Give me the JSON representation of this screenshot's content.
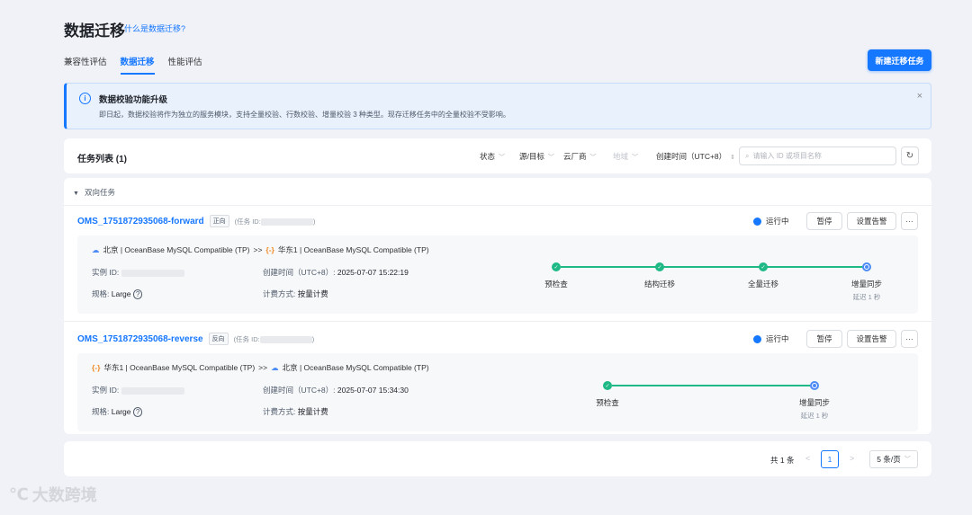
{
  "header": {
    "title": "数据迁移",
    "help_link": "什么是数据迁移?"
  },
  "tabs": [
    {
      "label": "兼容性评估",
      "active": false
    },
    {
      "label": "数据迁移",
      "active": true
    },
    {
      "label": "性能评估",
      "active": false
    }
  ],
  "new_button": "新建迁移任务",
  "notice": {
    "title": "数据校验功能升级",
    "desc": "即日起，数据校验将作为独立的服务模块，支持全量校验、行数校验、增量校验 3 种类型。现存迁移任务中的全量校验不受影响。",
    "close": "×"
  },
  "list": {
    "title": "任务列表 (1)",
    "filters": [
      "状态",
      "源/目标",
      "云厂商",
      "地域",
      "创建时间（UTC+8）"
    ],
    "search_placeholder": "请输入 ID 或项目名称"
  },
  "group": {
    "label": "双向任务"
  },
  "tasks": [
    {
      "name": "OMS_1751872935068-forward",
      "tag": "正向",
      "id_label": "(任务 ID:",
      "id_close": ")",
      "status": "运行中",
      "pause": "暂停",
      "alarm": "设置告警",
      "more": "···",
      "source": "北京 | OceanBase MySQL Compatible (TP)",
      "arrow": ">>",
      "target": "华东1 | OceanBase MySQL Compatible (TP)",
      "instance_label": "实例 ID:",
      "spec_label": "规格:",
      "spec_value": "Large",
      "created_label": "创建时间（UTC+8）:",
      "created_value": "2025-07-07 15:22:19",
      "billing_label": "计费方式:",
      "billing_value": "按量计费",
      "steps": [
        {
          "label": "预检查",
          "state": "done"
        },
        {
          "label": "结构迁移",
          "state": "done"
        },
        {
          "label": "全量迁移",
          "state": "done"
        },
        {
          "label": "增量同步",
          "state": "running",
          "sub": "延迟 1 秒"
        }
      ]
    },
    {
      "name": "OMS_1751872935068-reverse",
      "tag": "反向",
      "id_label": "(任务 ID:",
      "id_close": ")",
      "status": "运行中",
      "pause": "暂停",
      "alarm": "设置告警",
      "more": "···",
      "source": "华东1 | OceanBase MySQL Compatible (TP)",
      "arrow": ">>",
      "target": "北京 | OceanBase MySQL Compatible (TP)",
      "instance_label": "实例 ID:",
      "spec_label": "规格:",
      "spec_value": "Large",
      "created_label": "创建时间（UTC+8）:",
      "created_value": "2025-07-07 15:34:30",
      "billing_label": "计费方式:",
      "billing_value": "按量计费",
      "steps": [
        {
          "label": "预检查",
          "state": "done"
        },
        {
          "label": "增量同步",
          "state": "running",
          "sub": "延迟 1 秒"
        }
      ]
    }
  ],
  "pagination": {
    "total": "共 1 条",
    "page": "1",
    "size": "5 条/页",
    "prev": "<",
    "next": ">"
  },
  "watermark": "大数跨境",
  "colors": {
    "accent": "#1677ff",
    "success": "#1fb985",
    "notice_bg": "#e9f1fd"
  }
}
